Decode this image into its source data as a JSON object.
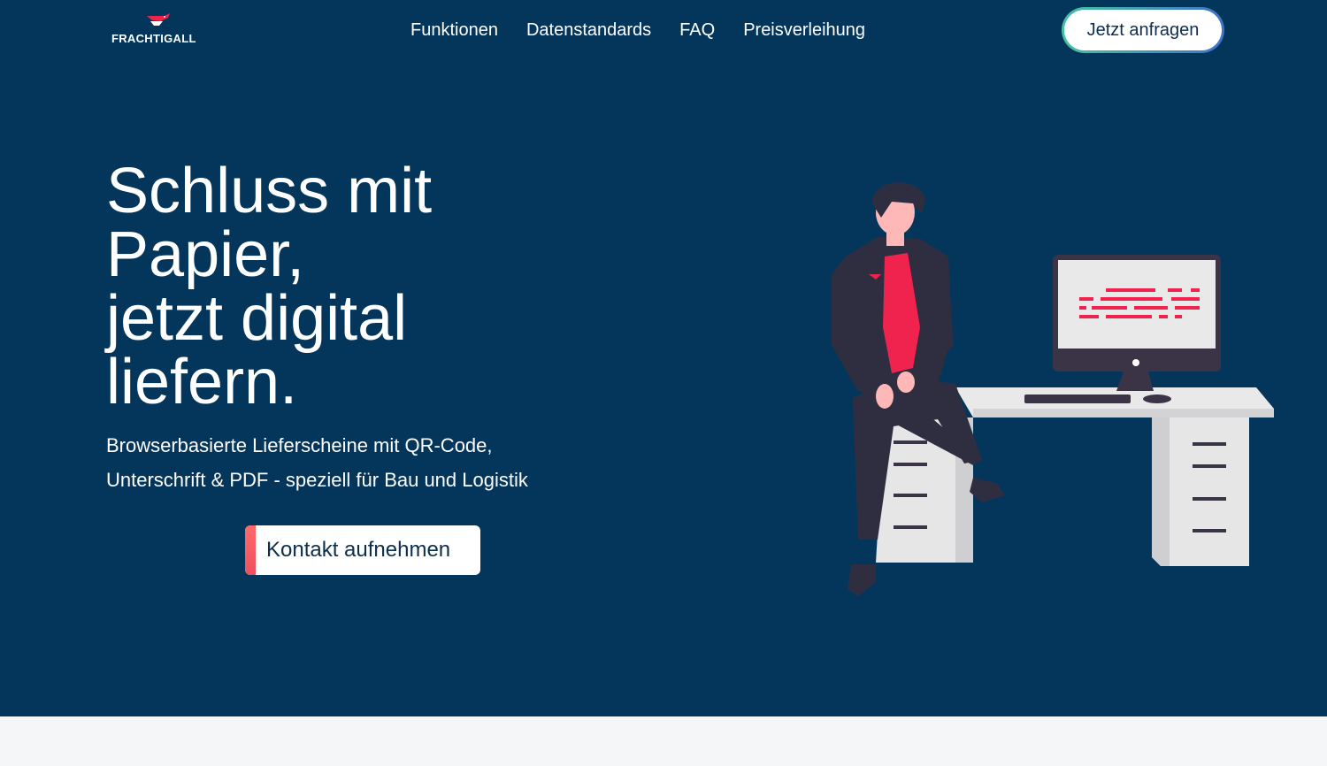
{
  "brand": {
    "name": "FRACHTIGALL",
    "accent": "#f0234e",
    "bg": "#04365c"
  },
  "nav": {
    "items": [
      "Funktionen",
      "Datenstandards",
      "FAQ",
      "Preisverleihung"
    ],
    "cta_label": "Jetzt anfragen"
  },
  "hero": {
    "headline_lines": [
      "Schluss mit",
      "Papier,",
      "jetzt digital",
      "liefern."
    ],
    "sub_lines": [
      "Browserbasierte Lieferscheine mit QR-Code,",
      "Unterschrift & PDF - speziell für Bau und Logistik"
    ],
    "contact_label": "Kontakt aufnehmen"
  },
  "icons": {
    "logo": "bird-logo-icon",
    "illustration": "person-at-desk-illustration"
  }
}
